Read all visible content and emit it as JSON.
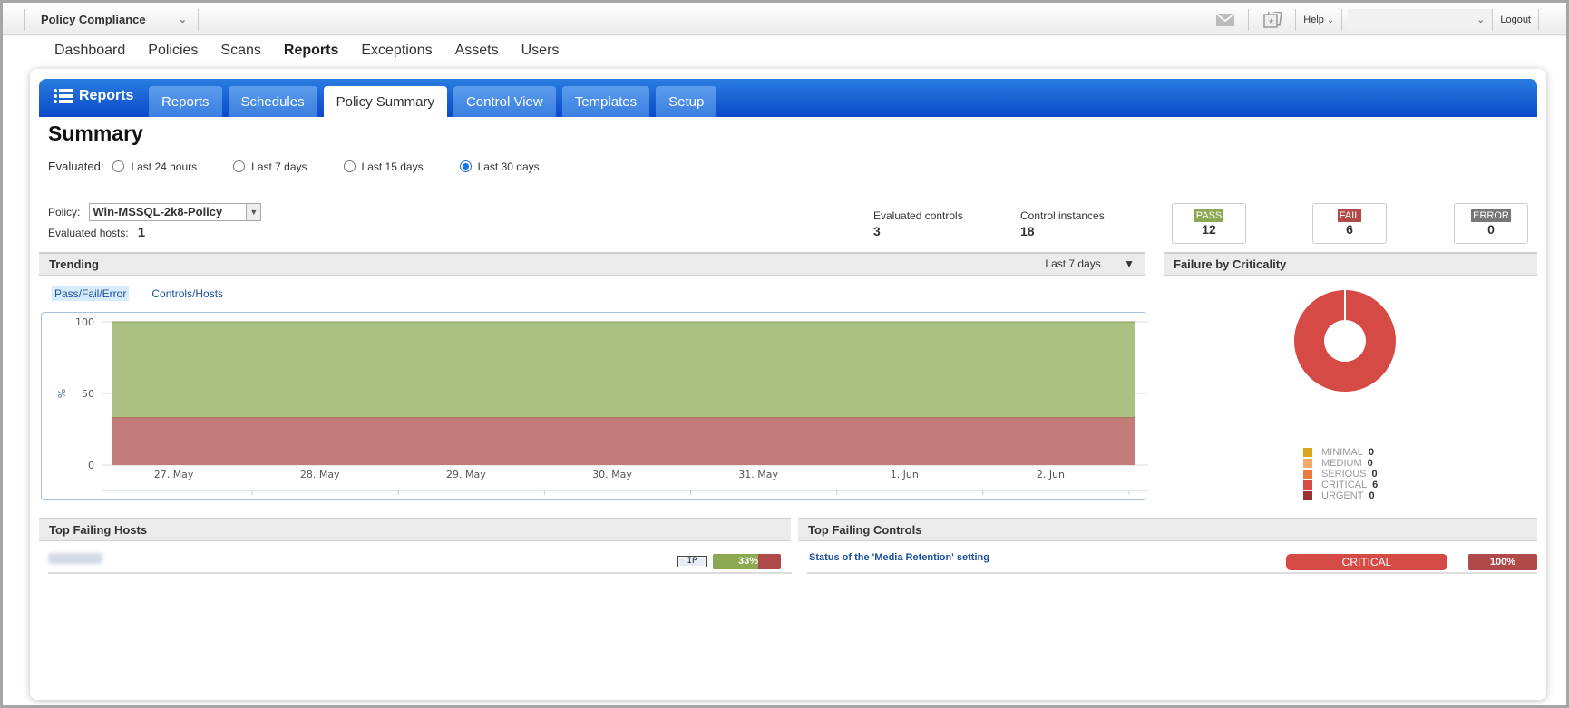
{
  "topbar": {
    "app_name": "Policy Compliance",
    "help_label": "Help",
    "user_menu_value": "",
    "logout_label": "Logout",
    "icons": [
      "mail-icon",
      "notifications-icon"
    ]
  },
  "main_nav": {
    "items": [
      "Dashboard",
      "Policies",
      "Scans",
      "Reports",
      "Exceptions",
      "Assets",
      "Users"
    ],
    "active": "Reports"
  },
  "module": {
    "title": "Reports",
    "tabs": [
      "Reports",
      "Schedules",
      "Policy Summary",
      "Control View",
      "Templates",
      "Setup"
    ],
    "active_tab": "Policy Summary"
  },
  "summary": {
    "title": "Summary",
    "evaluated_label": "Evaluated:",
    "evaluated_options": [
      "Last 24 hours",
      "Last 7 days",
      "Last 15 days",
      "Last 30 days"
    ],
    "evaluated_selected": "Last 30 days",
    "policy_label": "Policy:",
    "policy_value": "Win-MSSQL-2k8-Policy",
    "hosts_label": "Evaluated hosts:",
    "hosts_value": "1",
    "evaluated_controls_label": "Evaluated controls",
    "evaluated_controls_value": "3",
    "control_instances_label": "Control instances",
    "control_instances_value": "18",
    "pass_label": "PASS",
    "pass_value": "12",
    "fail_label": "FAIL",
    "fail_value": "6",
    "error_label": "ERROR",
    "error_value": "0"
  },
  "colors": {
    "pass": "#8ca852",
    "fail": "#b04a4a",
    "error": "#777777",
    "pass_area": "#adc084",
    "fail_area": "#c27b78",
    "critical": "#d54a45",
    "brand_blue": "#0b49c8"
  },
  "trending": {
    "title": "Trending",
    "range_value": "Last 7 days",
    "subtabs": [
      "Pass/Fail/Error",
      "Controls/Hosts"
    ],
    "active_subtab": "Pass/Fail/Error"
  },
  "failure_by_criticality": {
    "title": "Failure by Criticality"
  },
  "chart_data": [
    {
      "type": "area",
      "title": "Trending",
      "xlabel": "",
      "ylabel": "%",
      "ylim": [
        0,
        100
      ],
      "yticks": [
        "0",
        "50",
        "100"
      ],
      "x": [
        "27. May",
        "28. May",
        "29. May",
        "30. May",
        "31. May",
        "1. Jun",
        "2. Jun"
      ],
      "series": [
        {
          "name": "Fail",
          "color": "#c27b78",
          "values": [
            33.3,
            33.3,
            33.3,
            33.3,
            33.3,
            33.3,
            33.3
          ]
        },
        {
          "name": "Pass",
          "color": "#adc084",
          "values": [
            66.7,
            66.7,
            66.7,
            66.7,
            66.7,
            66.7,
            66.7
          ]
        }
      ],
      "stacked": true,
      "grid": true
    },
    {
      "type": "pie",
      "title": "Failure by Criticality",
      "donut": true,
      "legend_position": "bottom",
      "categories": [
        "MINIMAL",
        "MEDIUM",
        "SERIOUS",
        "CRITICAL",
        "URGENT"
      ],
      "values": [
        0,
        0,
        0,
        6,
        0
      ],
      "colors": [
        "#d9a51c",
        "#f7a86b",
        "#ea7a3c",
        "#d54a45",
        "#9c3232"
      ]
    }
  ],
  "top_failing_hosts": {
    "title": "Top Failing Hosts",
    "rows": [
      {
        "host": "",
        "badge": "IP",
        "pass_percent": 67,
        "label": "33%"
      }
    ]
  },
  "top_failing_controls": {
    "title": "Top Failing Controls",
    "rows": [
      {
        "control": "Status of the 'Media Retention' setting",
        "criticality": "CRITICAL",
        "percent": "100%"
      }
    ]
  }
}
